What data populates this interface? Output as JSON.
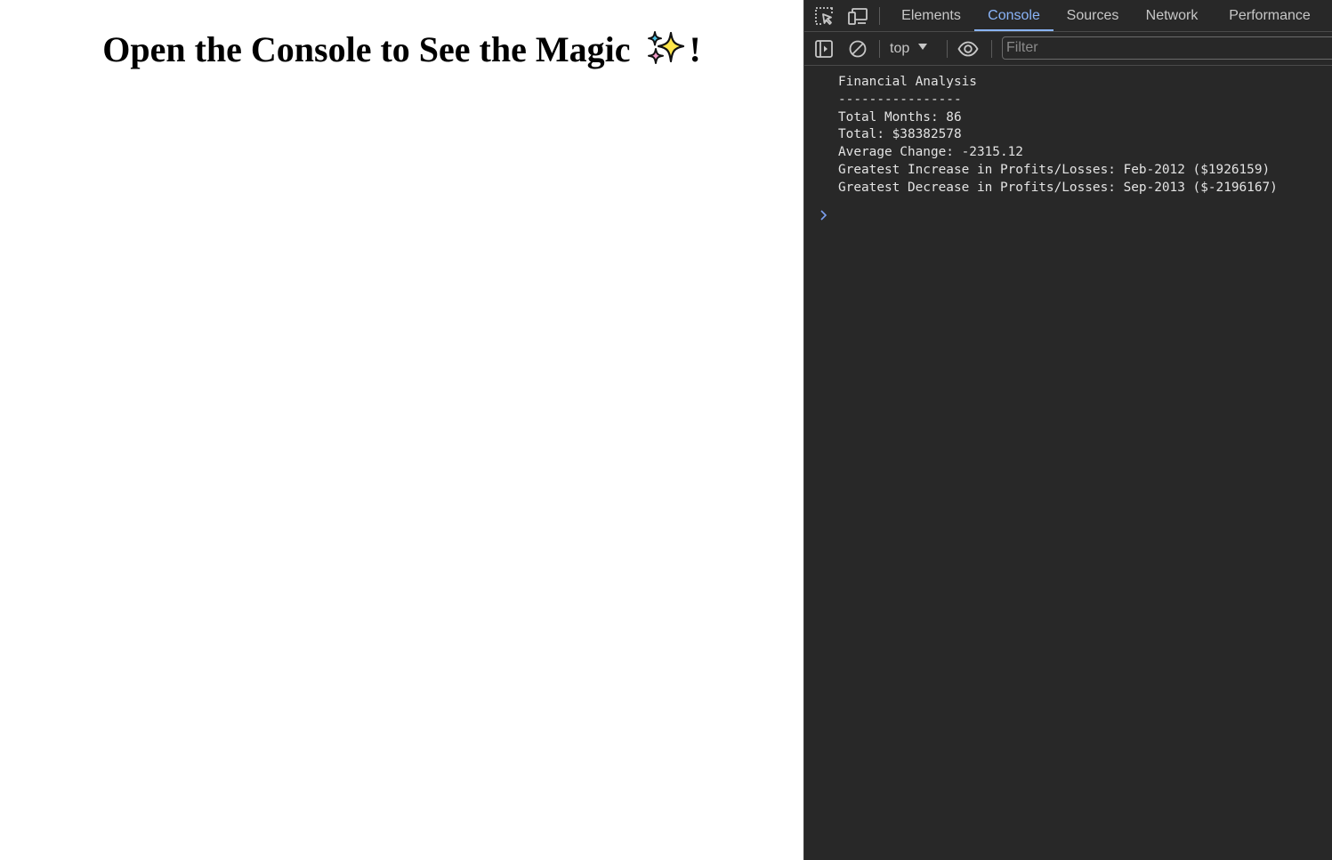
{
  "page": {
    "heading": "Open the Console to See the Magic ✨!",
    "heading_text": "Open the Console to See the Magic",
    "heading_suffix": "!",
    "sparkle_icon": "sparkles-icon"
  },
  "devtools": {
    "tabs": [
      {
        "label": "Elements"
      },
      {
        "label": "Console"
      },
      {
        "label": "Sources"
      },
      {
        "label": "Network"
      },
      {
        "label": "Performance"
      }
    ],
    "active_tab": "Console",
    "toolbar": {
      "context": "top",
      "filter_placeholder": "Filter",
      "filter_value": ""
    },
    "console_lines": [
      "Financial Analysis",
      "----------------",
      "Total Months: 86",
      "Total: $38382578",
      "Average Change: -2315.12",
      "Greatest Increase in Profits/Losses: Feb-2012 ($1926159)",
      "Greatest Decrease in Profits/Losses: Sep-2013 ($-2196167)"
    ],
    "icons": {
      "inspect": "inspect-element-icon",
      "device": "device-toolbar-icon",
      "sidebar": "show-sidebar-icon",
      "clear": "clear-console-icon",
      "eye": "live-expression-eye-icon",
      "prompt": "console-prompt-chevron-icon"
    },
    "colors": {
      "panel_bg": "#282828",
      "accent": "#8ab4f8",
      "text": "#e3e3e3"
    }
  }
}
